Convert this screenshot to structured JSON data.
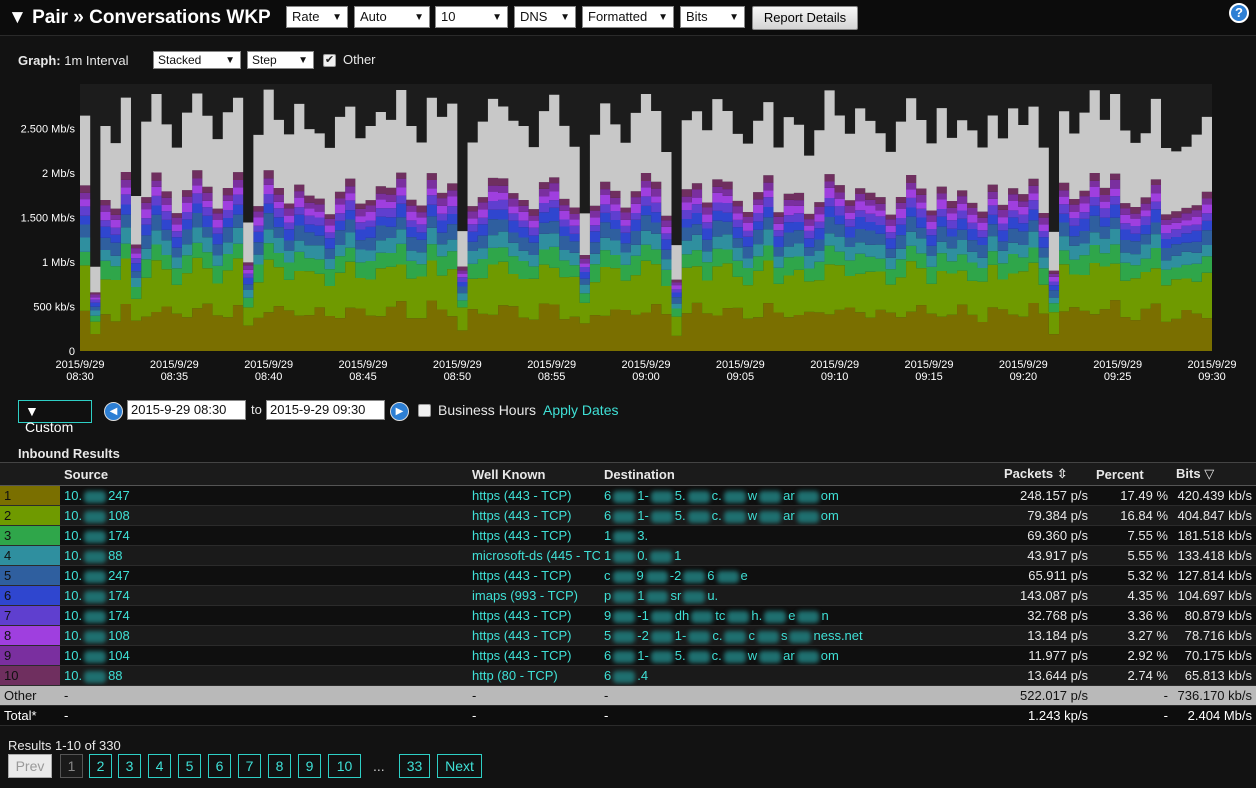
{
  "header": {
    "title": "▼ Pair » Conversations WKP",
    "selects": [
      {
        "name": "rate-select",
        "value": "Rate"
      },
      {
        "name": "auto-select",
        "value": "Auto"
      },
      {
        "name": "count-select",
        "value": "10"
      },
      {
        "name": "dns-select",
        "value": "DNS"
      },
      {
        "name": "formatted-select",
        "value": "Formatted"
      },
      {
        "name": "bits-select",
        "value": "Bits"
      }
    ],
    "report_button": "Report Details",
    "help": "?"
  },
  "graph_controls": {
    "label": "Graph:",
    "interval": "1m Interval",
    "mode": "Stacked",
    "style": "Step",
    "other_checked": true,
    "other_label": "Other"
  },
  "chart_data": {
    "type": "area",
    "stacked": true,
    "step": true,
    "ylabel": "",
    "yticks": [
      "0",
      "500 kb/s",
      "1 Mb/s",
      "1.500 Mb/s",
      "2 Mb/s",
      "2.500 Mb/s"
    ],
    "ytick_values": [
      0,
      0.5,
      1,
      1.5,
      2,
      2.5
    ],
    "ylim": [
      0,
      3
    ],
    "xticks": [
      [
        "2015/9/29",
        "08:30"
      ],
      [
        "2015/9/29",
        "08:35"
      ],
      [
        "2015/9/29",
        "08:40"
      ],
      [
        "2015/9/29",
        "08:45"
      ],
      [
        "2015/9/29",
        "08:50"
      ],
      [
        "2015/9/29",
        "08:55"
      ],
      [
        "2015/9/29",
        "09:00"
      ],
      [
        "2015/9/29",
        "09:05"
      ],
      [
        "2015/9/29",
        "09:10"
      ],
      [
        "2015/9/29",
        "09:15"
      ],
      [
        "2015/9/29",
        "09:20"
      ],
      [
        "2015/9/29",
        "09:25"
      ],
      [
        "2015/9/29",
        "09:30"
      ]
    ],
    "totals": [
      2.65,
      0.95,
      2.55,
      2.35,
      2.85,
      1.75,
      2.6,
      2.9,
      2.55,
      2.3,
      2.7,
      2.9,
      2.65,
      2.4,
      2.7,
      2.85,
      1.45,
      2.45,
      2.95,
      2.6,
      2.45,
      2.8,
      2.5,
      2.45,
      2.3,
      2.65,
      2.75,
      2.4,
      2.55,
      2.7,
      2.6,
      2.95,
      2.55,
      2.35,
      2.85,
      2.65,
      2.8,
      1.35,
      2.35,
      2.6,
      2.85,
      2.75,
      2.6,
      2.55,
      2.3,
      2.7,
      2.9,
      2.55,
      2.3,
      1.55,
      2.45,
      2.8,
      2.55,
      2.35,
      2.7,
      2.9,
      2.7,
      2.25,
      1.2,
      2.6,
      2.7,
      2.5,
      2.85,
      2.7,
      2.45,
      2.35,
      2.6,
      2.8,
      2.3,
      2.65,
      2.55,
      2.2,
      2.5,
      2.95,
      2.65,
      2.45,
      2.75,
      2.6,
      2.45,
      2.25,
      2.6,
      2.85,
      2.6,
      2.35,
      2.75,
      2.4,
      2.6,
      2.5,
      2.3,
      2.65,
      2.4,
      2.75,
      2.55,
      2.75,
      2.3,
      1.35,
      2.7,
      2.45,
      2.7,
      2.95,
      2.6,
      2.9,
      2.5,
      2.35,
      2.45,
      2.85,
      2.3,
      2.25,
      2.3,
      2.45,
      2.65
    ],
    "fractions": [
      0.17,
      0.17,
      0.07,
      0.055,
      0.053,
      0.044,
      0.034,
      0.033,
      0.029,
      0.027,
      0.31
    ],
    "colors": [
      "#7a6f00",
      "#6f9a00",
      "#2fa64a",
      "#2f8f9f",
      "#2f5f9f",
      "#2f46cf",
      "#5f3fcf",
      "#9f3fdf",
      "#7a2f9f",
      "#6f2f5f",
      "#c8c8c8"
    ]
  },
  "date_range": {
    "custom_label": "▼ Custom",
    "prev": "◀",
    "from": "2015-9-29 08:30",
    "to_label": "to",
    "to": "2015-9-29 09:30",
    "next": "▶",
    "business_hours_label": "Business Hours",
    "apply_label": "Apply Dates"
  },
  "results": {
    "title": "Inbound Results",
    "columns": {
      "source": "Source",
      "well_known": "Well Known",
      "destination": "Destination",
      "packets": "Packets",
      "percent": "Percent",
      "bits": "Bits"
    },
    "sort_icons": {
      "packets": "⇳",
      "bits": "▽"
    },
    "rows": [
      {
        "rank": "1",
        "color": "#7a6f00",
        "source_a": "10.",
        "source_b": "247",
        "well_known": "https (443 - TCP)",
        "dest_a": "6",
        "dest_b": "1-",
        "dest_c": "5.",
        "dest_d": "c.",
        "dest_e": "w",
        "dest_f": "ar",
        "dest_g": "om",
        "packets": "248.157 p/s",
        "percent": "17.49 %",
        "bits": "420.439 kb/s"
      },
      {
        "rank": "2",
        "color": "#6f9a00",
        "source_a": "10.",
        "source_b": "108",
        "well_known": "https (443 - TCP)",
        "dest_a": "6",
        "dest_b": "1-",
        "dest_c": "5.",
        "dest_d": "c.",
        "dest_e": "w",
        "dest_f": "ar",
        "dest_g": "om",
        "packets": "79.384 p/s",
        "percent": "16.84 %",
        "bits": "404.847 kb/s"
      },
      {
        "rank": "3",
        "color": "#2fa64a",
        "source_a": "10.",
        "source_b": "174",
        "well_known": "https (443 - TCP)",
        "dest_a": "1",
        "dest_b": "3.",
        "dest_c": "",
        "dest_d": "",
        "dest_e": "",
        "dest_f": "",
        "dest_g": "",
        "packets": "69.360 p/s",
        "percent": "7.55 %",
        "bits": "181.518 kb/s"
      },
      {
        "rank": "4",
        "color": "#2f8f9f",
        "source_a": "10.",
        "source_b": "88",
        "well_known": "microsoft-ds (445 - TC",
        "dest_a": "1",
        "dest_b": "0.",
        "dest_c": "1",
        "dest_d": "",
        "dest_e": "",
        "dest_f": "",
        "dest_g": "",
        "packets": "43.917 p/s",
        "percent": "5.55 %",
        "bits": "133.418 kb/s"
      },
      {
        "rank": "5",
        "color": "#2f5f9f",
        "source_a": "10.",
        "source_b": "247",
        "well_known": "https (443 - TCP)",
        "dest_a": "c",
        "dest_b": "9",
        "dest_c": "-2",
        "dest_d": "6",
        "dest_e": "e",
        "dest_f": "",
        "dest_g": "",
        "packets": "65.911 p/s",
        "percent": "5.32 %",
        "bits": "127.814 kb/s"
      },
      {
        "rank": "6",
        "color": "#2f46cf",
        "source_a": "10.",
        "source_b": "174",
        "well_known": "imaps (993 - TCP)",
        "dest_a": "p",
        "dest_b": "1",
        "dest_c": "sr",
        "dest_d": "u.",
        "dest_e": "",
        "dest_f": "",
        "dest_g": "",
        "packets": "143.087 p/s",
        "percent": "4.35 %",
        "bits": "104.697 kb/s"
      },
      {
        "rank": "7",
        "color": "#5f3fcf",
        "source_a": "10.",
        "source_b": "174",
        "well_known": "https (443 - TCP)",
        "dest_a": "9",
        "dest_b": "-1",
        "dest_c": "dh",
        "dest_d": "tc",
        "dest_e": "h.",
        "dest_f": "e",
        "dest_g": "n",
        "packets": "32.768 p/s",
        "percent": "3.36 %",
        "bits": "80.879 kb/s"
      },
      {
        "rank": "8",
        "color": "#9f3fdf",
        "source_a": "10.",
        "source_b": "108",
        "well_known": "https (443 - TCP)",
        "dest_a": "5",
        "dest_b": "-2",
        "dest_c": "1-",
        "dest_d": "c.",
        "dest_e": "c",
        "dest_f": "s",
        "dest_g": "ness.net",
        "packets": "13.184 p/s",
        "percent": "3.27 %",
        "bits": "78.716 kb/s"
      },
      {
        "rank": "9",
        "color": "#7a2f9f",
        "source_a": "10.",
        "source_b": "104",
        "well_known": "https (443 - TCP)",
        "dest_a": "6",
        "dest_b": "1-",
        "dest_c": "5.",
        "dest_d": "c.",
        "dest_e": "w",
        "dest_f": "ar",
        "dest_g": "om",
        "packets": "11.977 p/s",
        "percent": "2.92 %",
        "bits": "70.175 kb/s"
      },
      {
        "rank": "10",
        "color": "#6f2f5f",
        "source_a": "10.",
        "source_b": "88",
        "well_known": "http (80 - TCP)",
        "dest_a": "6",
        "dest_b": ".4",
        "dest_c": "",
        "dest_d": "",
        "dest_e": "",
        "dest_f": "",
        "dest_g": "",
        "packets": "13.644 p/s",
        "percent": "2.74 %",
        "bits": "65.813 kb/s"
      }
    ],
    "other": {
      "label": "Other",
      "source": "-",
      "well_known": "-",
      "destination": "-",
      "packets": "522.017 p/s",
      "percent": "-",
      "bits": "736.170 kb/s"
    },
    "total": {
      "label": "Total*",
      "source": "-",
      "well_known": "-",
      "destination": "-",
      "packets": "1.243 kp/s",
      "percent": "-",
      "bits": "2.404 Mb/s"
    }
  },
  "pagination": {
    "summary": "Results 1-10 of 330",
    "prev": "Prev",
    "pages": [
      "1",
      "2",
      "3",
      "4",
      "5",
      "6",
      "7",
      "8",
      "9",
      "10"
    ],
    "ellipsis": "...",
    "last": "33",
    "next": "Next"
  }
}
